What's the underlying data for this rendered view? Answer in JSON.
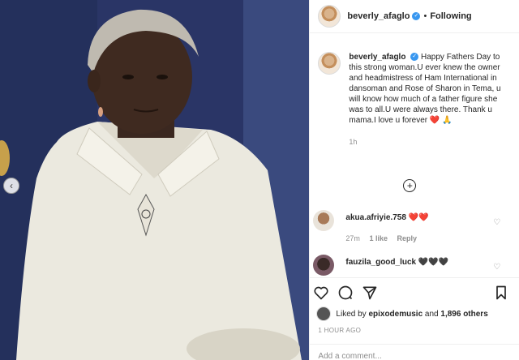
{
  "colors": {
    "link": "#262626",
    "secondary": "#8e8e8e",
    "verified": "#3897f0",
    "heart": "#ed4956"
  },
  "header": {
    "username": "beverly_afaglo",
    "separator": "•",
    "follow_status": "Following"
  },
  "caption": {
    "username": "beverly_afaglo",
    "text": "Happy Fathers Day to this strong woman.U ever knew the owner and headmistress of Ham International in dansoman and Rose of Sharon in Tema, u will know how much of a father figure she was to all.U were always there. Thank u mama.I love u forever",
    "emojis": "❤️ 🙏",
    "time_ago": "1h"
  },
  "load_more_icon": "plus-circle-icon",
  "comments": [
    {
      "username": "akua.afriyie.758",
      "text": "❤️❤️",
      "time": "27m",
      "likes": "1 like",
      "reply_label": "Reply"
    },
    {
      "username": "fauzila_good_luck",
      "text": "🖤🖤🖤"
    }
  ],
  "actions": {
    "icons": [
      "heart-icon",
      "comment-icon",
      "share-icon",
      "bookmark-icon"
    ]
  },
  "likes": {
    "prefix": "Liked by",
    "user": "epixodemusic",
    "connector": "and",
    "count": "1,896 others"
  },
  "timestamp": "1 HOUR AGO",
  "add_comment": {
    "placeholder": "Add a comment..."
  }
}
